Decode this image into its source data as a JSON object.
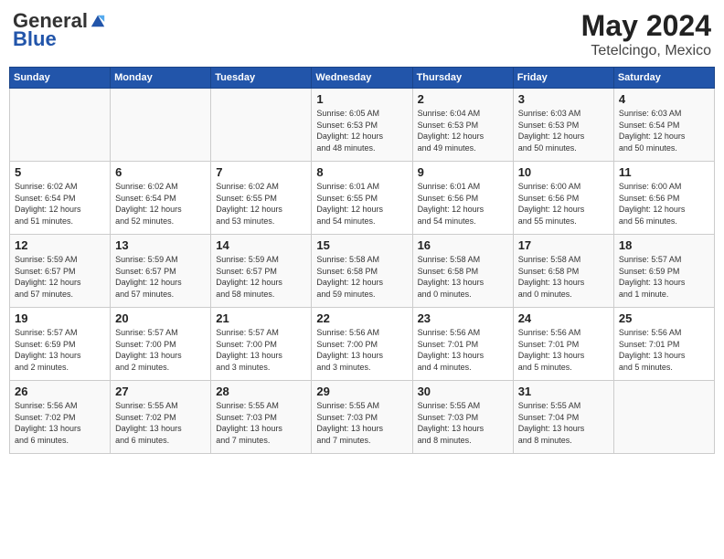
{
  "header": {
    "logo_general": "General",
    "logo_blue": "Blue",
    "title": "May 2024",
    "subtitle": "Tetelcingo, Mexico"
  },
  "days_of_week": [
    "Sunday",
    "Monday",
    "Tuesday",
    "Wednesday",
    "Thursday",
    "Friday",
    "Saturday"
  ],
  "weeks": [
    [
      {
        "day": "",
        "info": ""
      },
      {
        "day": "",
        "info": ""
      },
      {
        "day": "",
        "info": ""
      },
      {
        "day": "1",
        "info": "Sunrise: 6:05 AM\nSunset: 6:53 PM\nDaylight: 12 hours\nand 48 minutes."
      },
      {
        "day": "2",
        "info": "Sunrise: 6:04 AM\nSunset: 6:53 PM\nDaylight: 12 hours\nand 49 minutes."
      },
      {
        "day": "3",
        "info": "Sunrise: 6:03 AM\nSunset: 6:53 PM\nDaylight: 12 hours\nand 50 minutes."
      },
      {
        "day": "4",
        "info": "Sunrise: 6:03 AM\nSunset: 6:54 PM\nDaylight: 12 hours\nand 50 minutes."
      }
    ],
    [
      {
        "day": "5",
        "info": "Sunrise: 6:02 AM\nSunset: 6:54 PM\nDaylight: 12 hours\nand 51 minutes."
      },
      {
        "day": "6",
        "info": "Sunrise: 6:02 AM\nSunset: 6:54 PM\nDaylight: 12 hours\nand 52 minutes."
      },
      {
        "day": "7",
        "info": "Sunrise: 6:02 AM\nSunset: 6:55 PM\nDaylight: 12 hours\nand 53 minutes."
      },
      {
        "day": "8",
        "info": "Sunrise: 6:01 AM\nSunset: 6:55 PM\nDaylight: 12 hours\nand 54 minutes."
      },
      {
        "day": "9",
        "info": "Sunrise: 6:01 AM\nSunset: 6:56 PM\nDaylight: 12 hours\nand 54 minutes."
      },
      {
        "day": "10",
        "info": "Sunrise: 6:00 AM\nSunset: 6:56 PM\nDaylight: 12 hours\nand 55 minutes."
      },
      {
        "day": "11",
        "info": "Sunrise: 6:00 AM\nSunset: 6:56 PM\nDaylight: 12 hours\nand 56 minutes."
      }
    ],
    [
      {
        "day": "12",
        "info": "Sunrise: 5:59 AM\nSunset: 6:57 PM\nDaylight: 12 hours\nand 57 minutes."
      },
      {
        "day": "13",
        "info": "Sunrise: 5:59 AM\nSunset: 6:57 PM\nDaylight: 12 hours\nand 57 minutes."
      },
      {
        "day": "14",
        "info": "Sunrise: 5:59 AM\nSunset: 6:57 PM\nDaylight: 12 hours\nand 58 minutes."
      },
      {
        "day": "15",
        "info": "Sunrise: 5:58 AM\nSunset: 6:58 PM\nDaylight: 12 hours\nand 59 minutes."
      },
      {
        "day": "16",
        "info": "Sunrise: 5:58 AM\nSunset: 6:58 PM\nDaylight: 13 hours\nand 0 minutes."
      },
      {
        "day": "17",
        "info": "Sunrise: 5:58 AM\nSunset: 6:58 PM\nDaylight: 13 hours\nand 0 minutes."
      },
      {
        "day": "18",
        "info": "Sunrise: 5:57 AM\nSunset: 6:59 PM\nDaylight: 13 hours\nand 1 minute."
      }
    ],
    [
      {
        "day": "19",
        "info": "Sunrise: 5:57 AM\nSunset: 6:59 PM\nDaylight: 13 hours\nand 2 minutes."
      },
      {
        "day": "20",
        "info": "Sunrise: 5:57 AM\nSunset: 7:00 PM\nDaylight: 13 hours\nand 2 minutes."
      },
      {
        "day": "21",
        "info": "Sunrise: 5:57 AM\nSunset: 7:00 PM\nDaylight: 13 hours\nand 3 minutes."
      },
      {
        "day": "22",
        "info": "Sunrise: 5:56 AM\nSunset: 7:00 PM\nDaylight: 13 hours\nand 3 minutes."
      },
      {
        "day": "23",
        "info": "Sunrise: 5:56 AM\nSunset: 7:01 PM\nDaylight: 13 hours\nand 4 minutes."
      },
      {
        "day": "24",
        "info": "Sunrise: 5:56 AM\nSunset: 7:01 PM\nDaylight: 13 hours\nand 5 minutes."
      },
      {
        "day": "25",
        "info": "Sunrise: 5:56 AM\nSunset: 7:01 PM\nDaylight: 13 hours\nand 5 minutes."
      }
    ],
    [
      {
        "day": "26",
        "info": "Sunrise: 5:56 AM\nSunset: 7:02 PM\nDaylight: 13 hours\nand 6 minutes."
      },
      {
        "day": "27",
        "info": "Sunrise: 5:55 AM\nSunset: 7:02 PM\nDaylight: 13 hours\nand 6 minutes."
      },
      {
        "day": "28",
        "info": "Sunrise: 5:55 AM\nSunset: 7:03 PM\nDaylight: 13 hours\nand 7 minutes."
      },
      {
        "day": "29",
        "info": "Sunrise: 5:55 AM\nSunset: 7:03 PM\nDaylight: 13 hours\nand 7 minutes."
      },
      {
        "day": "30",
        "info": "Sunrise: 5:55 AM\nSunset: 7:03 PM\nDaylight: 13 hours\nand 8 minutes."
      },
      {
        "day": "31",
        "info": "Sunrise: 5:55 AM\nSunset: 7:04 PM\nDaylight: 13 hours\nand 8 minutes."
      },
      {
        "day": "",
        "info": ""
      }
    ]
  ]
}
